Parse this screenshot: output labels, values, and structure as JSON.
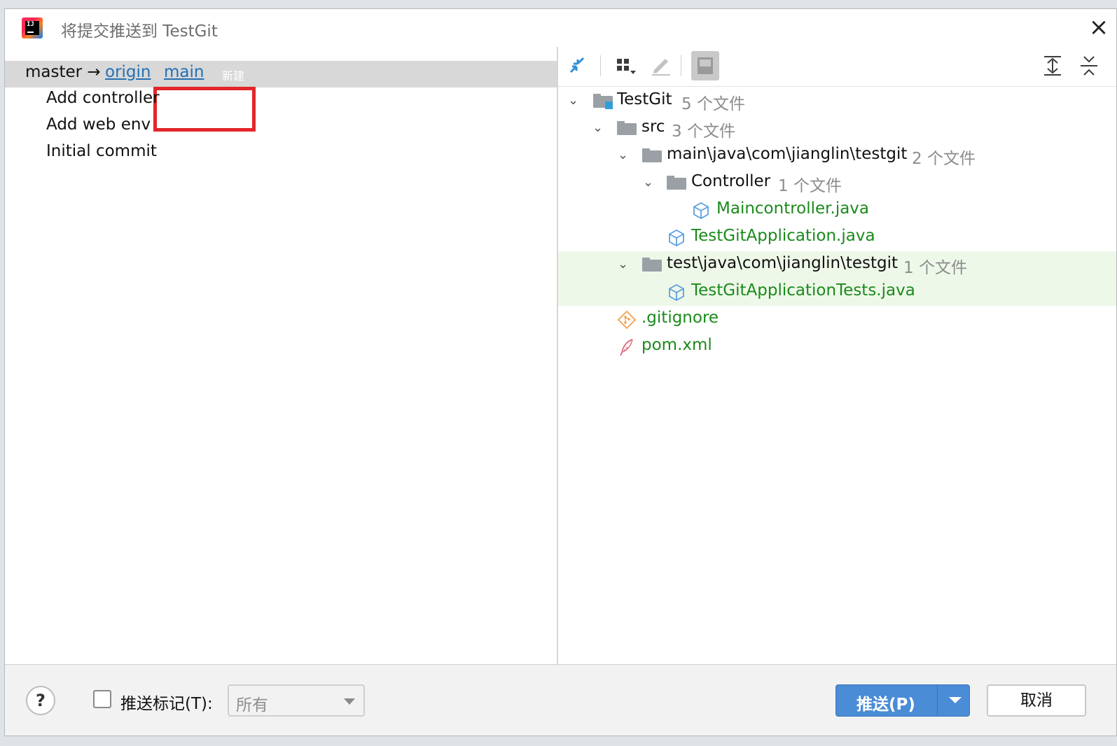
{
  "window": {
    "title": "将提交推送到 TestGit"
  },
  "push_target": {
    "local_branch": "master",
    "arrow": "→",
    "remote": "origin",
    "remote_branch": "main",
    "new_badge": "新建"
  },
  "commits": [
    "Add controller",
    "Add web env",
    "Initial commit"
  ],
  "toolbar": {
    "icons": [
      "pin-icon",
      "group-by-icon",
      "edit-icon",
      "show-diff-icon",
      "expand-all-icon",
      "collapse-all-icon"
    ]
  },
  "tree": {
    "root": {
      "name": "TestGit",
      "count": "5 个文件"
    },
    "src": {
      "name": "src",
      "count": "3 个文件"
    },
    "main_pkg": {
      "name": "main\\java\\com\\jianglin\\testgit",
      "count": "2 个文件"
    },
    "controller": {
      "name": "Controller",
      "count": "1 个文件"
    },
    "maincontroller": {
      "name": "Maincontroller.java"
    },
    "app": {
      "name": "TestGitApplication.java"
    },
    "test_pkg": {
      "name": "test\\java\\com\\jianglin\\testgit",
      "count": "1 个文件"
    },
    "app_tests": {
      "name": "TestGitApplicationTests.java"
    },
    "gitignore": {
      "name": ".gitignore"
    },
    "pom": {
      "name": "pom.xml"
    }
  },
  "footer": {
    "help": "?",
    "push_tags_label": "推送标记(T):",
    "tags_value": "所有",
    "push_label": "推送(P)",
    "cancel_label": "取消"
  },
  "colors": {
    "accent": "#4a8cd6",
    "link": "#2470b3",
    "added_file": "#1b8a1b",
    "highlight": "#e3262a"
  }
}
